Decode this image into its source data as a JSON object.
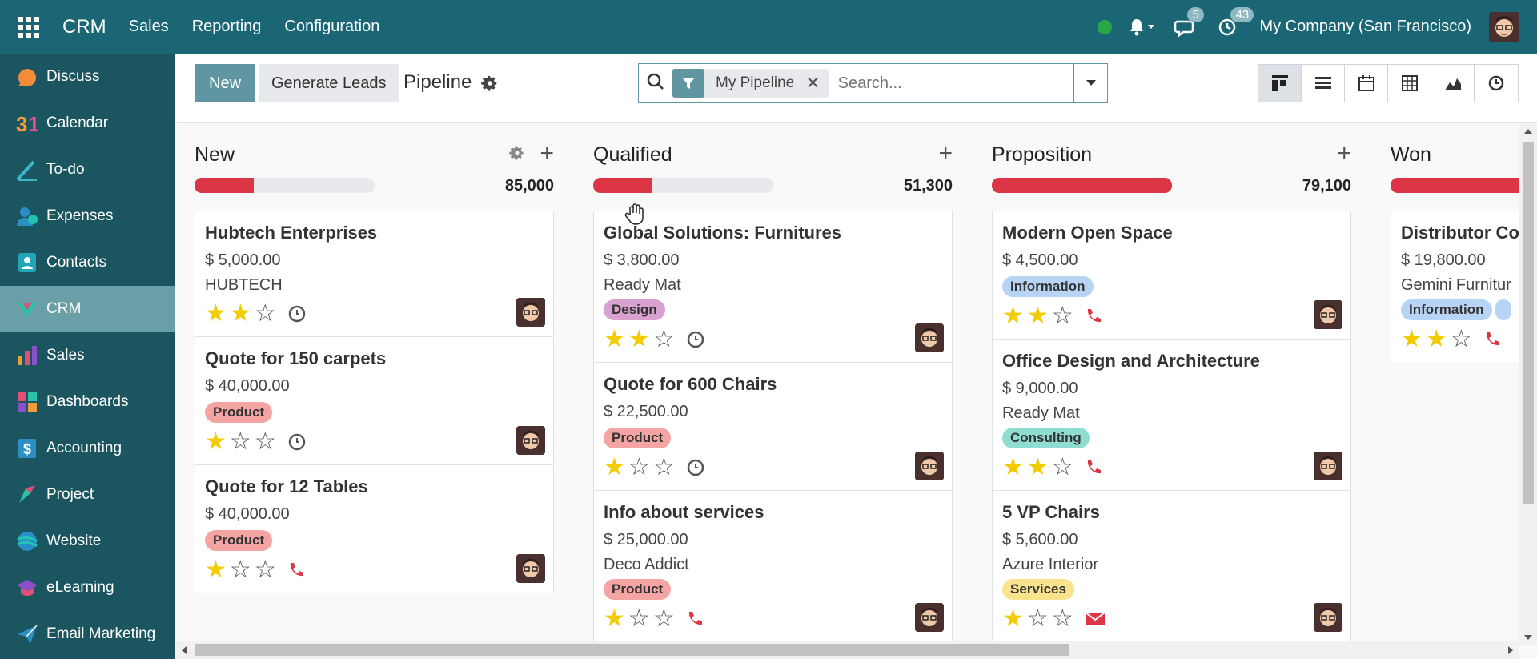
{
  "topbar": {
    "brand": "CRM",
    "menus": [
      "Sales",
      "Reporting",
      "Configuration"
    ],
    "badges": {
      "messages": "5",
      "activities": "43"
    },
    "company": "My Company (San Francisco)"
  },
  "sidebar": {
    "items": [
      {
        "label": "Discuss",
        "icon": "discuss-icon"
      },
      {
        "label": "Calendar",
        "icon": "calendar-icon"
      },
      {
        "label": "To-do",
        "icon": "todo-icon"
      },
      {
        "label": "Expenses",
        "icon": "expenses-icon"
      },
      {
        "label": "Contacts",
        "icon": "contacts-icon"
      },
      {
        "label": "CRM",
        "icon": "crm-icon"
      },
      {
        "label": "Sales",
        "icon": "sales-icon"
      },
      {
        "label": "Dashboards",
        "icon": "dashboards-icon"
      },
      {
        "label": "Accounting",
        "icon": "accounting-icon"
      },
      {
        "label": "Project",
        "icon": "project-icon"
      },
      {
        "label": "Website",
        "icon": "website-icon"
      },
      {
        "label": "eLearning",
        "icon": "elearning-icon"
      },
      {
        "label": "Email Marketing",
        "icon": "email-marketing-icon"
      }
    ]
  },
  "control_panel": {
    "new_label": "New",
    "generate_label": "Generate Leads",
    "title": "Pipeline",
    "facet": "My Pipeline",
    "search_placeholder": "Search..."
  },
  "columns": [
    {
      "title": "New",
      "total": "85,000",
      "progress": 0.33,
      "cards": [
        {
          "title": "Hubtech Enterprises",
          "revenue": "$ 5,000.00",
          "partner": "HUBTECH",
          "tag": "",
          "stars": 2,
          "activity": "clock"
        },
        {
          "title": "Quote for 150 carpets",
          "revenue": "$ 40,000.00",
          "partner": "",
          "tag": "Product",
          "stars": 1,
          "activity": "clock"
        },
        {
          "title": "Quote for 12 Tables",
          "revenue": "$ 40,000.00",
          "partner": "",
          "tag": "Product",
          "stars": 1,
          "activity": "phone"
        }
      ]
    },
    {
      "title": "Qualified",
      "total": "51,300",
      "progress": 0.33,
      "cards": [
        {
          "title": "Global Solutions: Furnitures",
          "revenue": "$ 3,800.00",
          "partner": "Ready Mat",
          "tag": "Design",
          "stars": 2,
          "activity": "clock"
        },
        {
          "title": "Quote for 600 Chairs",
          "revenue": "$ 22,500.00",
          "partner": "",
          "tag": "Product",
          "stars": 1,
          "activity": "clock"
        },
        {
          "title": "Info about services",
          "revenue": "$ 25,000.00",
          "partner": "Deco Addict",
          "tag": "Product",
          "stars": 1,
          "activity": "phone"
        }
      ]
    },
    {
      "title": "Proposition",
      "total": "79,100",
      "progress": 1.0,
      "cards": [
        {
          "title": "Modern Open Space",
          "revenue": "$ 4,500.00",
          "partner": "",
          "tag": "Information",
          "stars": 2,
          "activity": "phone"
        },
        {
          "title": "Office Design and Architecture",
          "revenue": "$ 9,000.00",
          "partner": "Ready Mat",
          "tag": "Consulting",
          "stars": 2,
          "activity": "phone"
        },
        {
          "title": "5 VP Chairs",
          "revenue": "$ 5,600.00",
          "partner": "Azure Interior",
          "tag": "Services",
          "stars": 1,
          "activity": "mail"
        }
      ]
    },
    {
      "title": "Won",
      "total": "",
      "progress": 1.0,
      "cards": [
        {
          "title": "Distributor Co",
          "revenue": "$ 19,800.00",
          "partner": "Gemini Furnitur",
          "tag": "Information",
          "stars": 2,
          "activity": "phone"
        }
      ]
    }
  ],
  "colors": {
    "topbar": "#1a6675",
    "sidebar": "#1a5560",
    "accent": "#5f96a1",
    "danger": "#dc3545",
    "star": "#f3cc00"
  }
}
